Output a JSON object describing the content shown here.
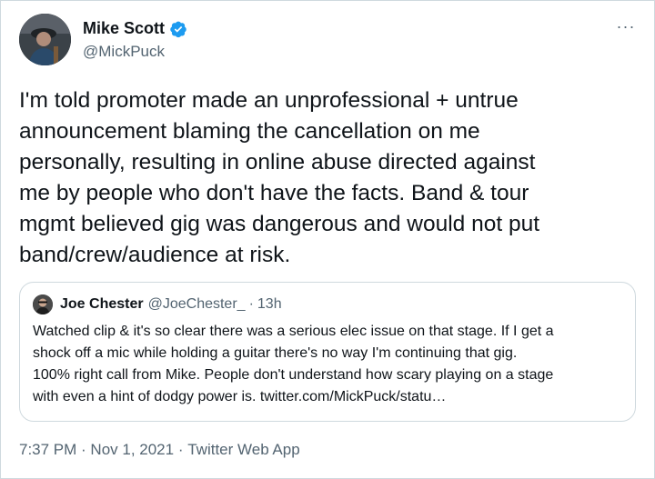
{
  "author": {
    "display_name": "Mike Scott",
    "handle": "@MickPuck",
    "verified": true
  },
  "more_glyph": "···",
  "tweet": {
    "text": "I'm told promoter made an unprofessional + untrue\nannouncement blaming the cancellation on me\npersonally, resulting in online abuse directed against\nme by people who don't have the facts. Band & tour\nmgmt believed gig was dangerous and would not put\nband/crew/audience at risk."
  },
  "quoted_tweet": {
    "display_name": "Joe Chester",
    "handle": "@JoeChester_",
    "separator": "·",
    "time": "13h",
    "text": "Watched clip & it's so clear there was a serious elec issue on that stage. If I get a\nshock off a mic while holding a guitar there's no way I'm continuing that gig.\n100% right call from Mike. People don't understand how scary playing on a stage\nwith even a hint of dodgy power is. twitter.com/MickPuck/statu…"
  },
  "meta": {
    "time": "7:37 PM",
    "separator": " · ",
    "date": "Nov 1, 2021",
    "source": "Twitter Web App"
  },
  "colors": {
    "verified_blue": "#1d9bf0",
    "secondary_text": "#536471",
    "border": "#cfd9de"
  }
}
